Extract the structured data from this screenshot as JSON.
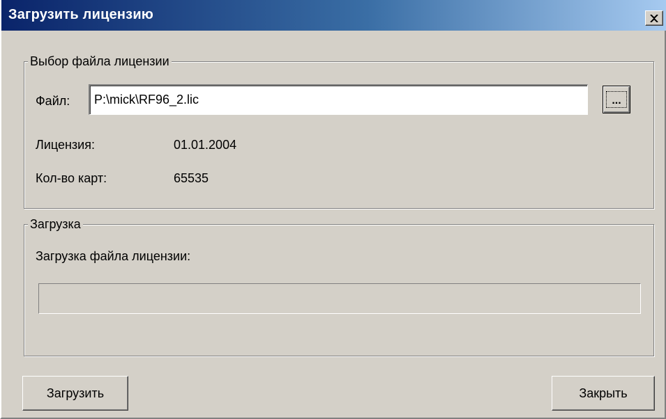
{
  "window": {
    "title": "Загрузить лицензию",
    "close_label": "✕"
  },
  "file_group": {
    "legend": "Выбор файла лицензии",
    "file_label": "Файл:",
    "file_value": "P:\\mick\\RF96_2.lic",
    "browse_label": "...",
    "license_label": "Лицензия:",
    "license_value": "01.01.2004",
    "cards_label": "Кол-во карт:",
    "cards_value": "65535"
  },
  "load_group": {
    "legend": "Загрузка",
    "status_label": "Загрузка файла лицензии:",
    "progress_percent": 0
  },
  "buttons": {
    "load_label": "Загрузить",
    "close_label": "Закрыть"
  },
  "colors": {
    "title_start": "#0a246a",
    "title_end": "#a6caf0",
    "face": "#d4d0c8"
  }
}
